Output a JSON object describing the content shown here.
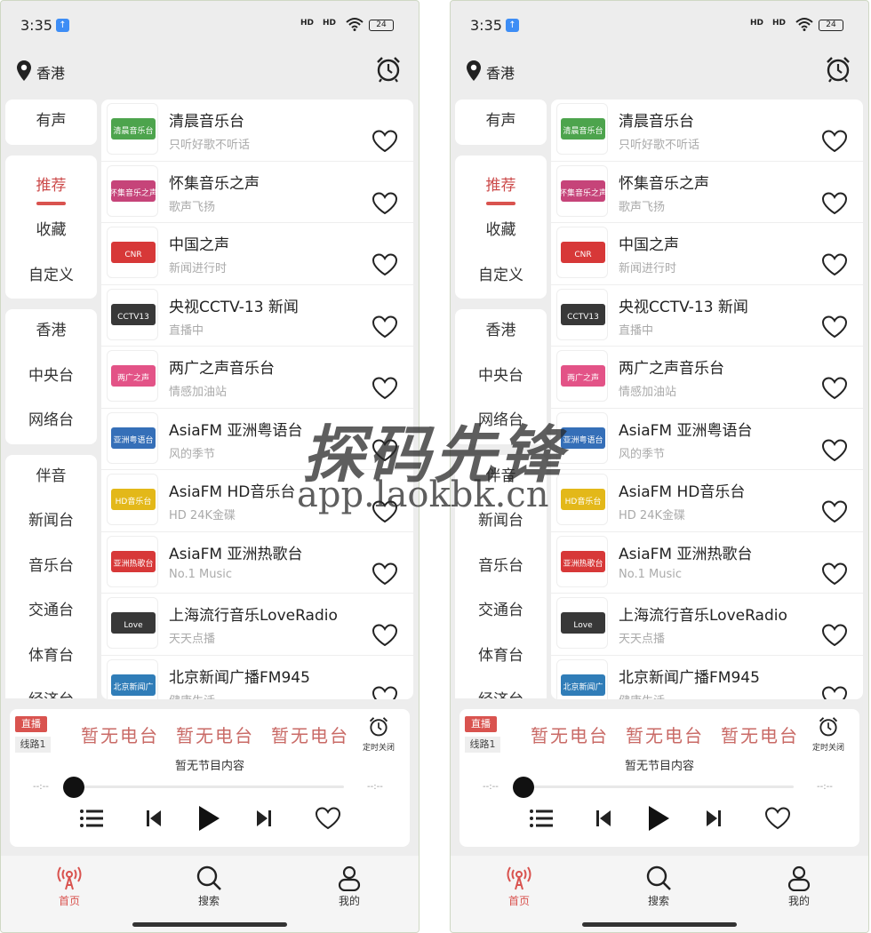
{
  "status": {
    "time": "3:35",
    "sig1": "HD",
    "sig2": "HD",
    "battery": "24"
  },
  "header": {
    "location": "香港"
  },
  "sidebar": {
    "group1": [
      "有声"
    ],
    "group2": [
      "推荐",
      "收藏",
      "自定义"
    ],
    "group3": [
      "香港",
      "中央台",
      "网络台"
    ],
    "group4": [
      "伴音",
      "新闻台",
      "音乐台",
      "交通台",
      "体育台",
      "经济台"
    ]
  },
  "stations": [
    {
      "title": "清晨音乐台",
      "subtitle": "只听好歌不听话",
      "logo_text": "清晨音乐台",
      "logo_color": "#3a9a3a"
    },
    {
      "title": "怀集音乐之声",
      "subtitle": "歌声飞扬",
      "logo_text": "怀集音乐之声",
      "logo_color": "#c0306a"
    },
    {
      "title": "中国之声",
      "subtitle": "新闻进行时",
      "logo_text": "CNR",
      "logo_color": "#d32222"
    },
    {
      "title": "央视CCTV-13 新闻",
      "subtitle": "直播中",
      "logo_text": "CCTV13",
      "logo_color": "#222222"
    },
    {
      "title": "两广之声音乐台",
      "subtitle": "情感加油站",
      "logo_text": "两广之声",
      "logo_color": "#e0407a"
    },
    {
      "title": "AsiaFM 亚洲粤语台",
      "subtitle": "风的季节",
      "logo_text": "亚洲粤语台",
      "logo_color": "#1f5fb0"
    },
    {
      "title": "AsiaFM HD音乐台",
      "subtitle": "HD 24K金碟",
      "logo_text": "HD音乐台",
      "logo_color": "#e0b000"
    },
    {
      "title": "AsiaFM 亚洲热歌台",
      "subtitle": "No.1 Music",
      "logo_text": "亚洲热歌台",
      "logo_color": "#d32222"
    },
    {
      "title": "上海流行音乐LoveRadio",
      "subtitle": "天天点播",
      "logo_text": "Love",
      "logo_color": "#222222"
    },
    {
      "title": "北京新闻广播FM945",
      "subtitle": "健康生活",
      "logo_text": "北京新闻广",
      "logo_color": "#1a6fb0"
    }
  ],
  "player": {
    "live": "直播",
    "line": "线路1",
    "now_playing": [
      "暂无电台",
      "暂无电台",
      "暂无电台"
    ],
    "timer_label": "定时关闭",
    "program": "暂无节目内容",
    "time_start": "--:--",
    "time_end": "--:--",
    "progress": 0
  },
  "tabs": [
    {
      "label": "首页",
      "icon": "radio-icon",
      "active": true
    },
    {
      "label": "搜索",
      "icon": "search-icon"
    },
    {
      "label": "我的",
      "icon": "user-icon"
    }
  ],
  "watermark": {
    "title": "探码先锋",
    "url": "app.laokbk.cn"
  },
  "colors": {
    "accent": "#d9534f",
    "background": "#ededed"
  }
}
